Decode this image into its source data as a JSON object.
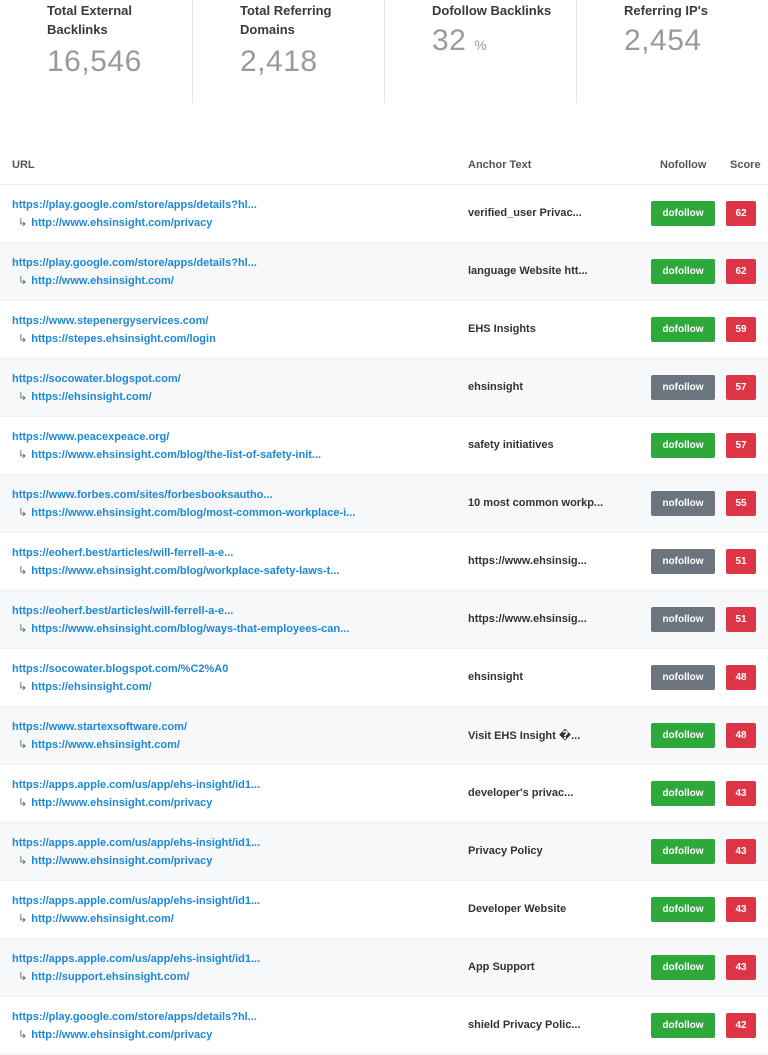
{
  "stats": [
    {
      "label_line1": "Total External",
      "label_line2": "Backlinks",
      "value": "16,546",
      "unit": ""
    },
    {
      "label_line1": "Total Referring",
      "label_line2": "Domains",
      "value": "2,418",
      "unit": ""
    },
    {
      "label_line1": "Dofollow Backlinks",
      "label_line2": "",
      "value": "32",
      "unit": "%"
    },
    {
      "label_line1": "Referring IP's",
      "label_line2": "",
      "value": "2,454",
      "unit": ""
    }
  ],
  "table": {
    "columns": {
      "url": "URL",
      "anchor": "Anchor Text",
      "nofollow": "Nofollow",
      "score": "Score"
    },
    "arrow_glyph": "↳",
    "rows": [
      {
        "url": "https://play.google.com/store/apps/details?hl...",
        "target": "http://www.ehsinsight.com/privacy",
        "anchor": "verified_user Privac...",
        "follow": "dofollow",
        "score": "62"
      },
      {
        "url": "https://play.google.com/store/apps/details?hl...",
        "target": "http://www.ehsinsight.com/",
        "anchor": "language Website htt...",
        "follow": "dofollow",
        "score": "62"
      },
      {
        "url": "https://www.stepenergyservices.com/",
        "target": "https://stepes.ehsinsight.com/login",
        "anchor": "EHS Insights",
        "follow": "dofollow",
        "score": "59"
      },
      {
        "url": "https://socowater.blogspot.com/",
        "target": "https://ehsinsight.com/",
        "anchor": "ehsinsight",
        "follow": "nofollow",
        "score": "57"
      },
      {
        "url": "https://www.peacexpeace.org/",
        "target": "https://www.ehsinsight.com/blog/the-list-of-safety-init...",
        "anchor": "safety initiatives",
        "follow": "dofollow",
        "score": "57"
      },
      {
        "url": "https://www.forbes.com/sites/forbesbooksautho...",
        "target": "https://www.ehsinsight.com/blog/most-common-workplace-i...",
        "anchor": "10 most common workp...",
        "follow": "nofollow",
        "score": "55"
      },
      {
        "url": "https://eoherf.best/articles/will-ferrell-a-e...",
        "target": "https://www.ehsinsight.com/blog/workplace-safety-laws-t...",
        "anchor": "https://www.ehsinsig...",
        "follow": "nofollow",
        "score": "51"
      },
      {
        "url": "https://eoherf.best/articles/will-ferrell-a-e...",
        "target": "https://www.ehsinsight.com/blog/ways-that-employees-can...",
        "anchor": "https://www.ehsinsig...",
        "follow": "nofollow",
        "score": "51"
      },
      {
        "url": "https://socowater.blogspot.com/%C2%A0",
        "target": "https://ehsinsight.com/",
        "anchor": "ehsinsight",
        "follow": "nofollow",
        "score": "48"
      },
      {
        "url": "https://www.startexsoftware.com/",
        "target": "https://www.ehsinsight.com/",
        "anchor": "Visit EHS Insight �...",
        "follow": "dofollow",
        "score": "48"
      },
      {
        "url": "https://apps.apple.com/us/app/ehs-insight/id1...",
        "target": "http://www.ehsinsight.com/privacy",
        "anchor": "developer's privac...",
        "follow": "dofollow",
        "score": "43"
      },
      {
        "url": "https://apps.apple.com/us/app/ehs-insight/id1...",
        "target": "http://www.ehsinsight.com/privacy",
        "anchor": "Privacy Policy",
        "follow": "dofollow",
        "score": "43"
      },
      {
        "url": "https://apps.apple.com/us/app/ehs-insight/id1...",
        "target": "http://www.ehsinsight.com/",
        "anchor": "Developer Website",
        "follow": "dofollow",
        "score": "43"
      },
      {
        "url": "https://apps.apple.com/us/app/ehs-insight/id1...",
        "target": "http://support.ehsinsight.com/",
        "anchor": "App Support",
        "follow": "dofollow",
        "score": "43"
      },
      {
        "url": "https://play.google.com/store/apps/details?hl...",
        "target": "http://www.ehsinsight.com/privacy",
        "anchor": "shield Privacy Polic...",
        "follow": "dofollow",
        "score": "42"
      }
    ]
  }
}
